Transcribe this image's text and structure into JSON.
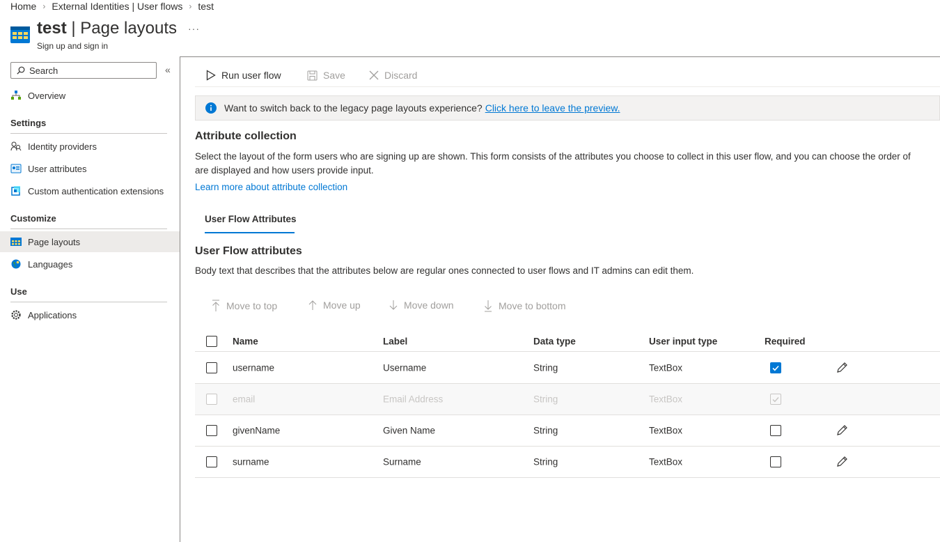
{
  "breadcrumb": {
    "items": [
      "Home",
      "External Identities | User flows",
      "test"
    ]
  },
  "header": {
    "title_bold": "test",
    "title_rest": "| Page layouts",
    "subtitle": "Sign up and sign in",
    "more": "···"
  },
  "sidebar": {
    "search_placeholder": "Search",
    "collapse": "«",
    "overview": "Overview",
    "sections": {
      "settings": "Settings",
      "customize": "Customize",
      "use": "Use"
    },
    "settings_items": [
      "Identity providers",
      "User attributes",
      "Custom authentication extensions"
    ],
    "customize_items": [
      "Page layouts",
      "Languages"
    ],
    "use_items": [
      "Applications"
    ]
  },
  "toolbar": {
    "run": "Run user flow",
    "save": "Save",
    "discard": "Discard"
  },
  "info": {
    "text": "Want to switch back to the legacy page layouts experience?",
    "link": "Click here to leave the preview."
  },
  "attribute_collection": {
    "heading": "Attribute collection",
    "description": "Select the layout of the form users who are signing up are shown. This form consists of the attributes you choose to collect in this user flow, and you can choose the order of",
    "description_line2": "are displayed and how users provide input.",
    "learn_more": "Learn more about attribute collection"
  },
  "tabs": [
    "User Flow Attributes"
  ],
  "user_flow_attributes": {
    "heading": "User Flow attributes",
    "body": "Body text that describes that the attributes below are regular ones connected to user flows and IT admins can edit them."
  },
  "move": {
    "top": "Move to top",
    "up": "Move up",
    "down": "Move down",
    "bottom": "Move to bottom"
  },
  "grid": {
    "columns": [
      "Name",
      "Label",
      "Data type",
      "User input type",
      "Required"
    ],
    "rows": [
      {
        "name": "username",
        "label": "Username",
        "data_type": "String",
        "input_type": "TextBox",
        "required": true,
        "disabled": false
      },
      {
        "name": "email",
        "label": "Email Address",
        "data_type": "String",
        "input_type": "TextBox",
        "required": true,
        "disabled": true
      },
      {
        "name": "givenName",
        "label": "Given Name",
        "data_type": "String",
        "input_type": "TextBox",
        "required": false,
        "disabled": false
      },
      {
        "name": "surname",
        "label": "Surname",
        "data_type": "String",
        "input_type": "TextBox",
        "required": false,
        "disabled": false
      }
    ]
  },
  "colors": {
    "accent": "#0078d4",
    "text": "#323130",
    "disabled": "#a19f9d"
  }
}
